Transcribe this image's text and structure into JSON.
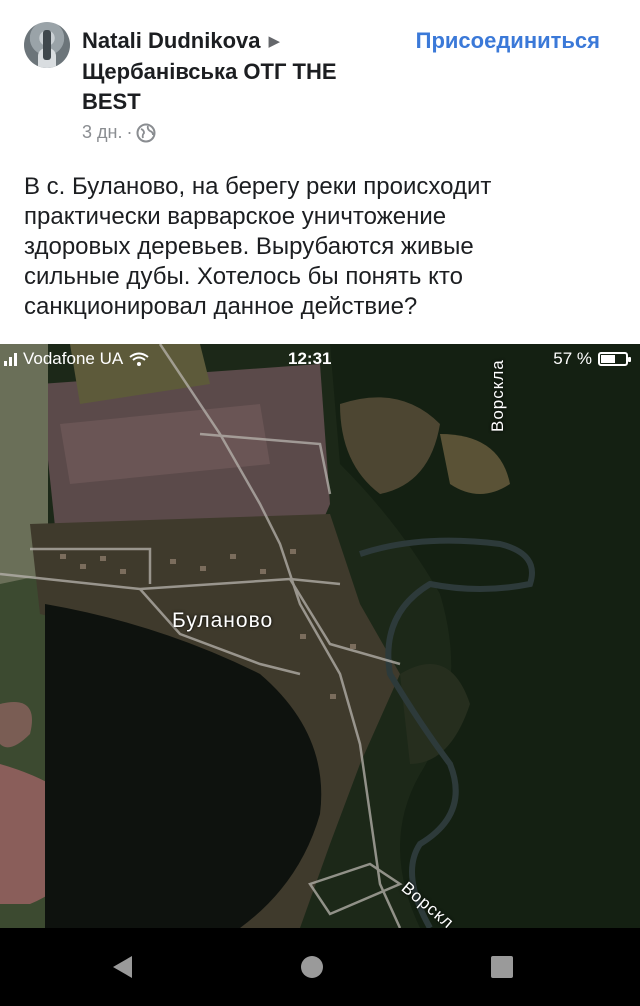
{
  "post": {
    "author": "Natali Dudnikova",
    "group": "Щербанівська ОТГ THE BEST",
    "join_label": "Присоединиться",
    "time_ago": "3 дн.",
    "separator": "·",
    "privacy_icon": "globe-icon",
    "text": "В с. Буланово, на берегу реки происходит\nпрактически варварское уничтожение\nздоровых деревьев. Вырубаются живые\nсильные дубы. Хотелось бы понять кто\nсанкционировал данное действие?"
  },
  "screenshot": {
    "status_bar": {
      "carrier": "Vodafone UA",
      "time": "12:31",
      "battery_percent": "57 %",
      "battery_level": 0.57
    },
    "map": {
      "village_label": "Буланово",
      "river_label_top": "Ворскла",
      "river_label_bottom": "Ворскл"
    }
  },
  "navbar": {
    "back_icon": "back-triangle-icon",
    "home_icon": "home-circle-icon",
    "recents_icon": "recents-square-icon"
  },
  "colors": {
    "link": "#3b79d8",
    "text": "#1c1e21",
    "meta": "#8a8d91",
    "navbar": "#000000"
  }
}
